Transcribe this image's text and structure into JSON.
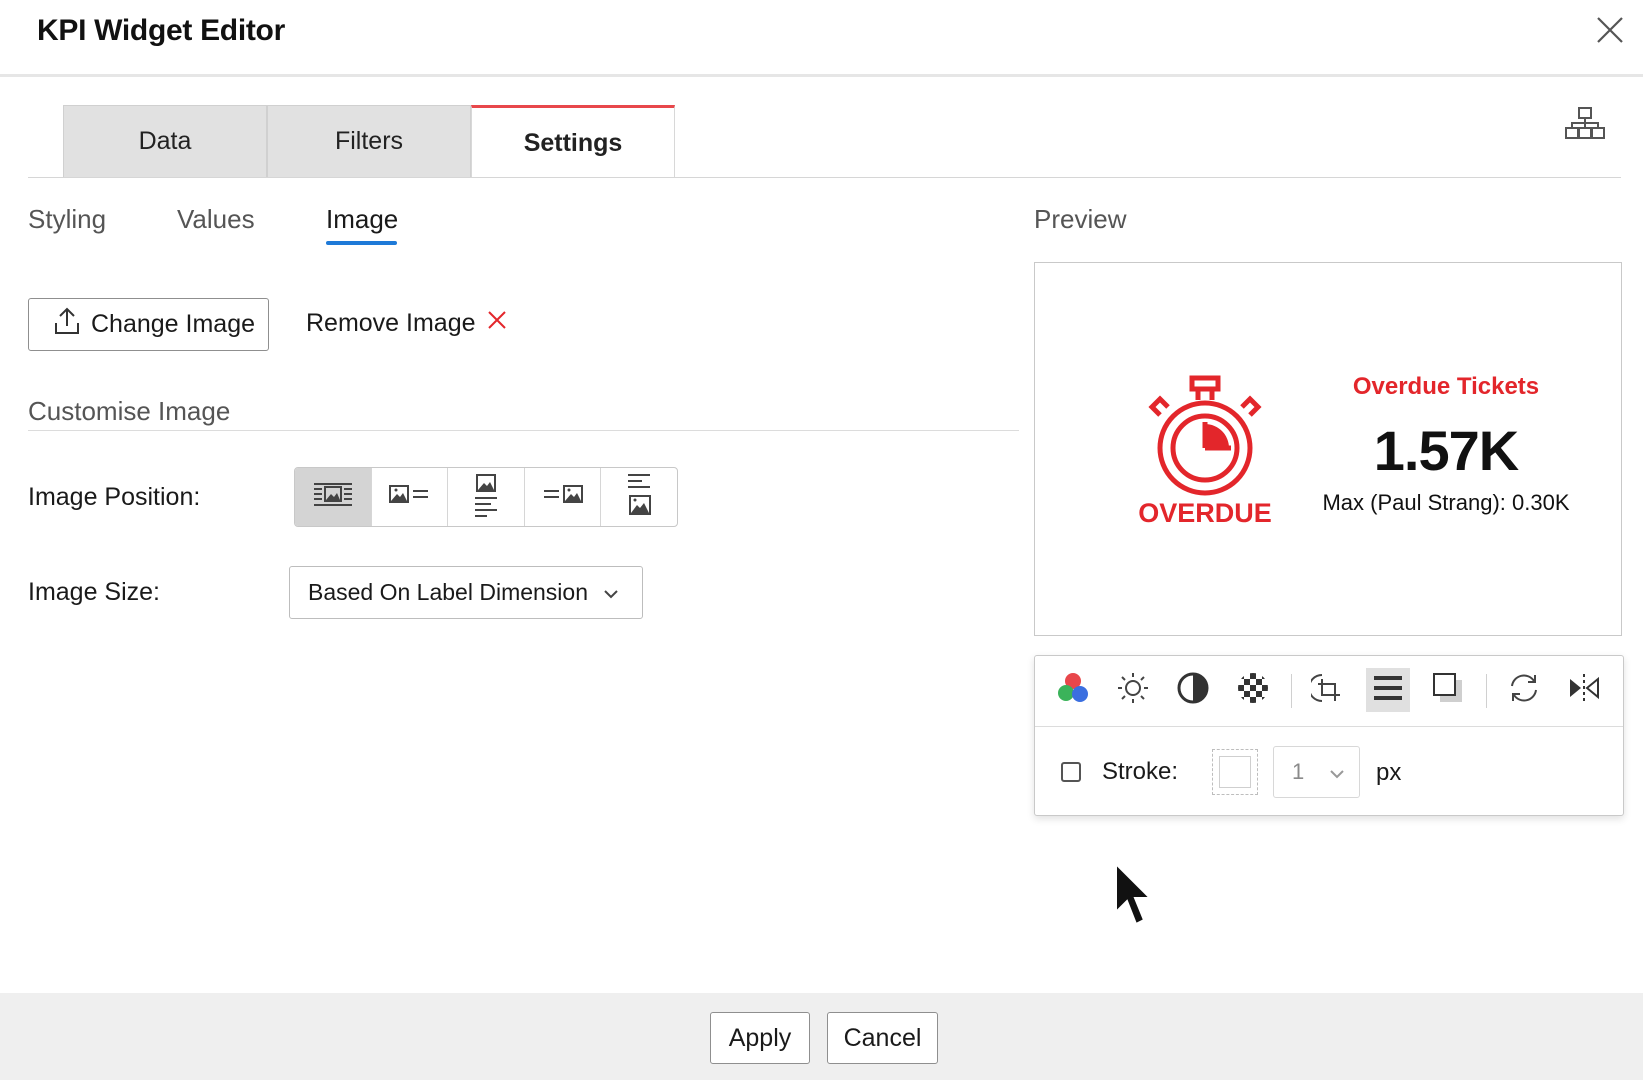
{
  "dialog": {
    "title": "KPI Widget Editor"
  },
  "tabs": [
    {
      "label": "Data",
      "active": false
    },
    {
      "label": "Filters",
      "active": false
    },
    {
      "label": "Settings",
      "active": true
    }
  ],
  "subtabs": [
    {
      "label": "Styling",
      "active": false
    },
    {
      "label": "Values",
      "active": false
    },
    {
      "label": "Image",
      "active": true
    }
  ],
  "image_actions": {
    "change_label": "Change Image",
    "remove_label": "Remove Image"
  },
  "customise": {
    "section_title": "Customise Image",
    "position_label": "Image Position:",
    "position_options": [
      {
        "icon": "image-inline-text-icon",
        "selected": true
      },
      {
        "icon": "image-left-icon",
        "selected": false
      },
      {
        "icon": "image-top-icon",
        "selected": false
      },
      {
        "icon": "image-right-icon",
        "selected": false
      },
      {
        "icon": "image-bottom-icon",
        "selected": false
      }
    ],
    "size_label": "Image Size:",
    "size_value": "Based On Label Dimension"
  },
  "preview": {
    "title": "Preview",
    "kpi_label": "Overdue Tickets",
    "kpi_value": "1.57K",
    "kpi_sub": "Max (Paul Strang): 0.30K",
    "image_text": "OVERDUE",
    "accent_color": "#e3262b"
  },
  "image_toolbar": {
    "tools": [
      "color-icon",
      "brightness-icon",
      "contrast-icon",
      "transparency-icon",
      "crop-icon",
      "stroke-icon",
      "shadow-icon",
      "rotate-icon",
      "flip-icon"
    ],
    "active_tool": "stroke-icon",
    "stroke_label": "Stroke:",
    "stroke_checked": false,
    "stroke_width": "1",
    "stroke_unit": "px"
  },
  "footer": {
    "apply_label": "Apply",
    "cancel_label": "Cancel"
  }
}
